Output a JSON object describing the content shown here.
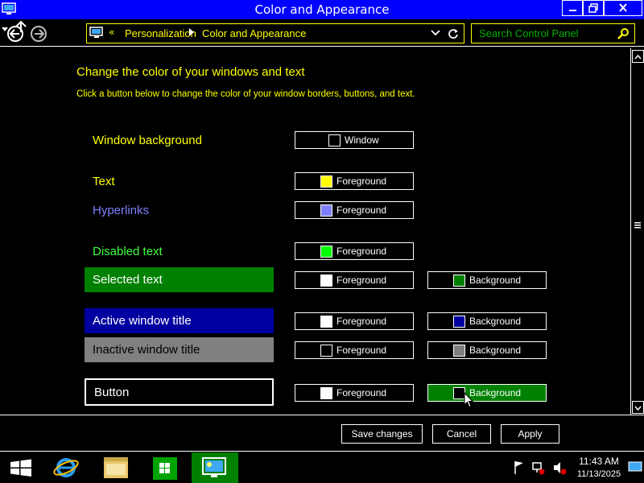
{
  "window": {
    "title": "Color and Appearance"
  },
  "nav": {
    "chevrons": "«",
    "breadcrumb": [
      "Personalization",
      "Color and Appearance"
    ],
    "search_placeholder": "Search Control Panel"
  },
  "content": {
    "heading": "Change the color of your windows and text",
    "subheading": "Click a button below to change the color of your window borders, buttons, and text.",
    "rows": {
      "window_background": {
        "label": "Window background",
        "label_color": "#ffff00",
        "button": "Window",
        "swatch": "#000000"
      },
      "text": {
        "label": "Text",
        "label_color": "#ffff00",
        "button": "Foreground",
        "swatch": "#ffff00"
      },
      "hyperlinks": {
        "label": "Hyperlinks",
        "label_color": "#8080ff",
        "button": "Foreground",
        "swatch": "#8080ff"
      },
      "disabled_text": {
        "label": "Disabled text",
        "label_color": "#3fff3f",
        "button": "Foreground",
        "swatch": "#00ff00"
      },
      "selected_text": {
        "label": "Selected text",
        "bg": "#008000",
        "fg": "#ffffff",
        "fg_button": "Foreground",
        "fg_swatch": "#ffffff",
        "bg_button": "Background",
        "bg_swatch": "#008000"
      },
      "active_title": {
        "label": "Active window title",
        "bg": "#0000a0",
        "fg": "#ffffff",
        "fg_button": "Foreground",
        "fg_swatch": "#ffffff",
        "bg_button": "Background",
        "bg_swatch": "#0000a0"
      },
      "inactive_title": {
        "label": "Inactive window title",
        "bg": "#808080",
        "fg": "#000000",
        "fg_button": "Foreground",
        "fg_swatch": "#000000",
        "bg_button": "Background",
        "bg_swatch": "#808080"
      },
      "button": {
        "label": "Button",
        "bg": "#000000",
        "fg": "#ffffff",
        "fg_button": "Foreground",
        "fg_swatch": "#ffffff",
        "bg_button": "Background",
        "bg_swatch": "#000000"
      }
    }
  },
  "footer": {
    "save": "Save changes",
    "cancel": "Cancel",
    "apply": "Apply"
  },
  "taskbar": {
    "time": "11:43 AM",
    "date": "11/13/2025",
    "active_color": "#008000"
  }
}
